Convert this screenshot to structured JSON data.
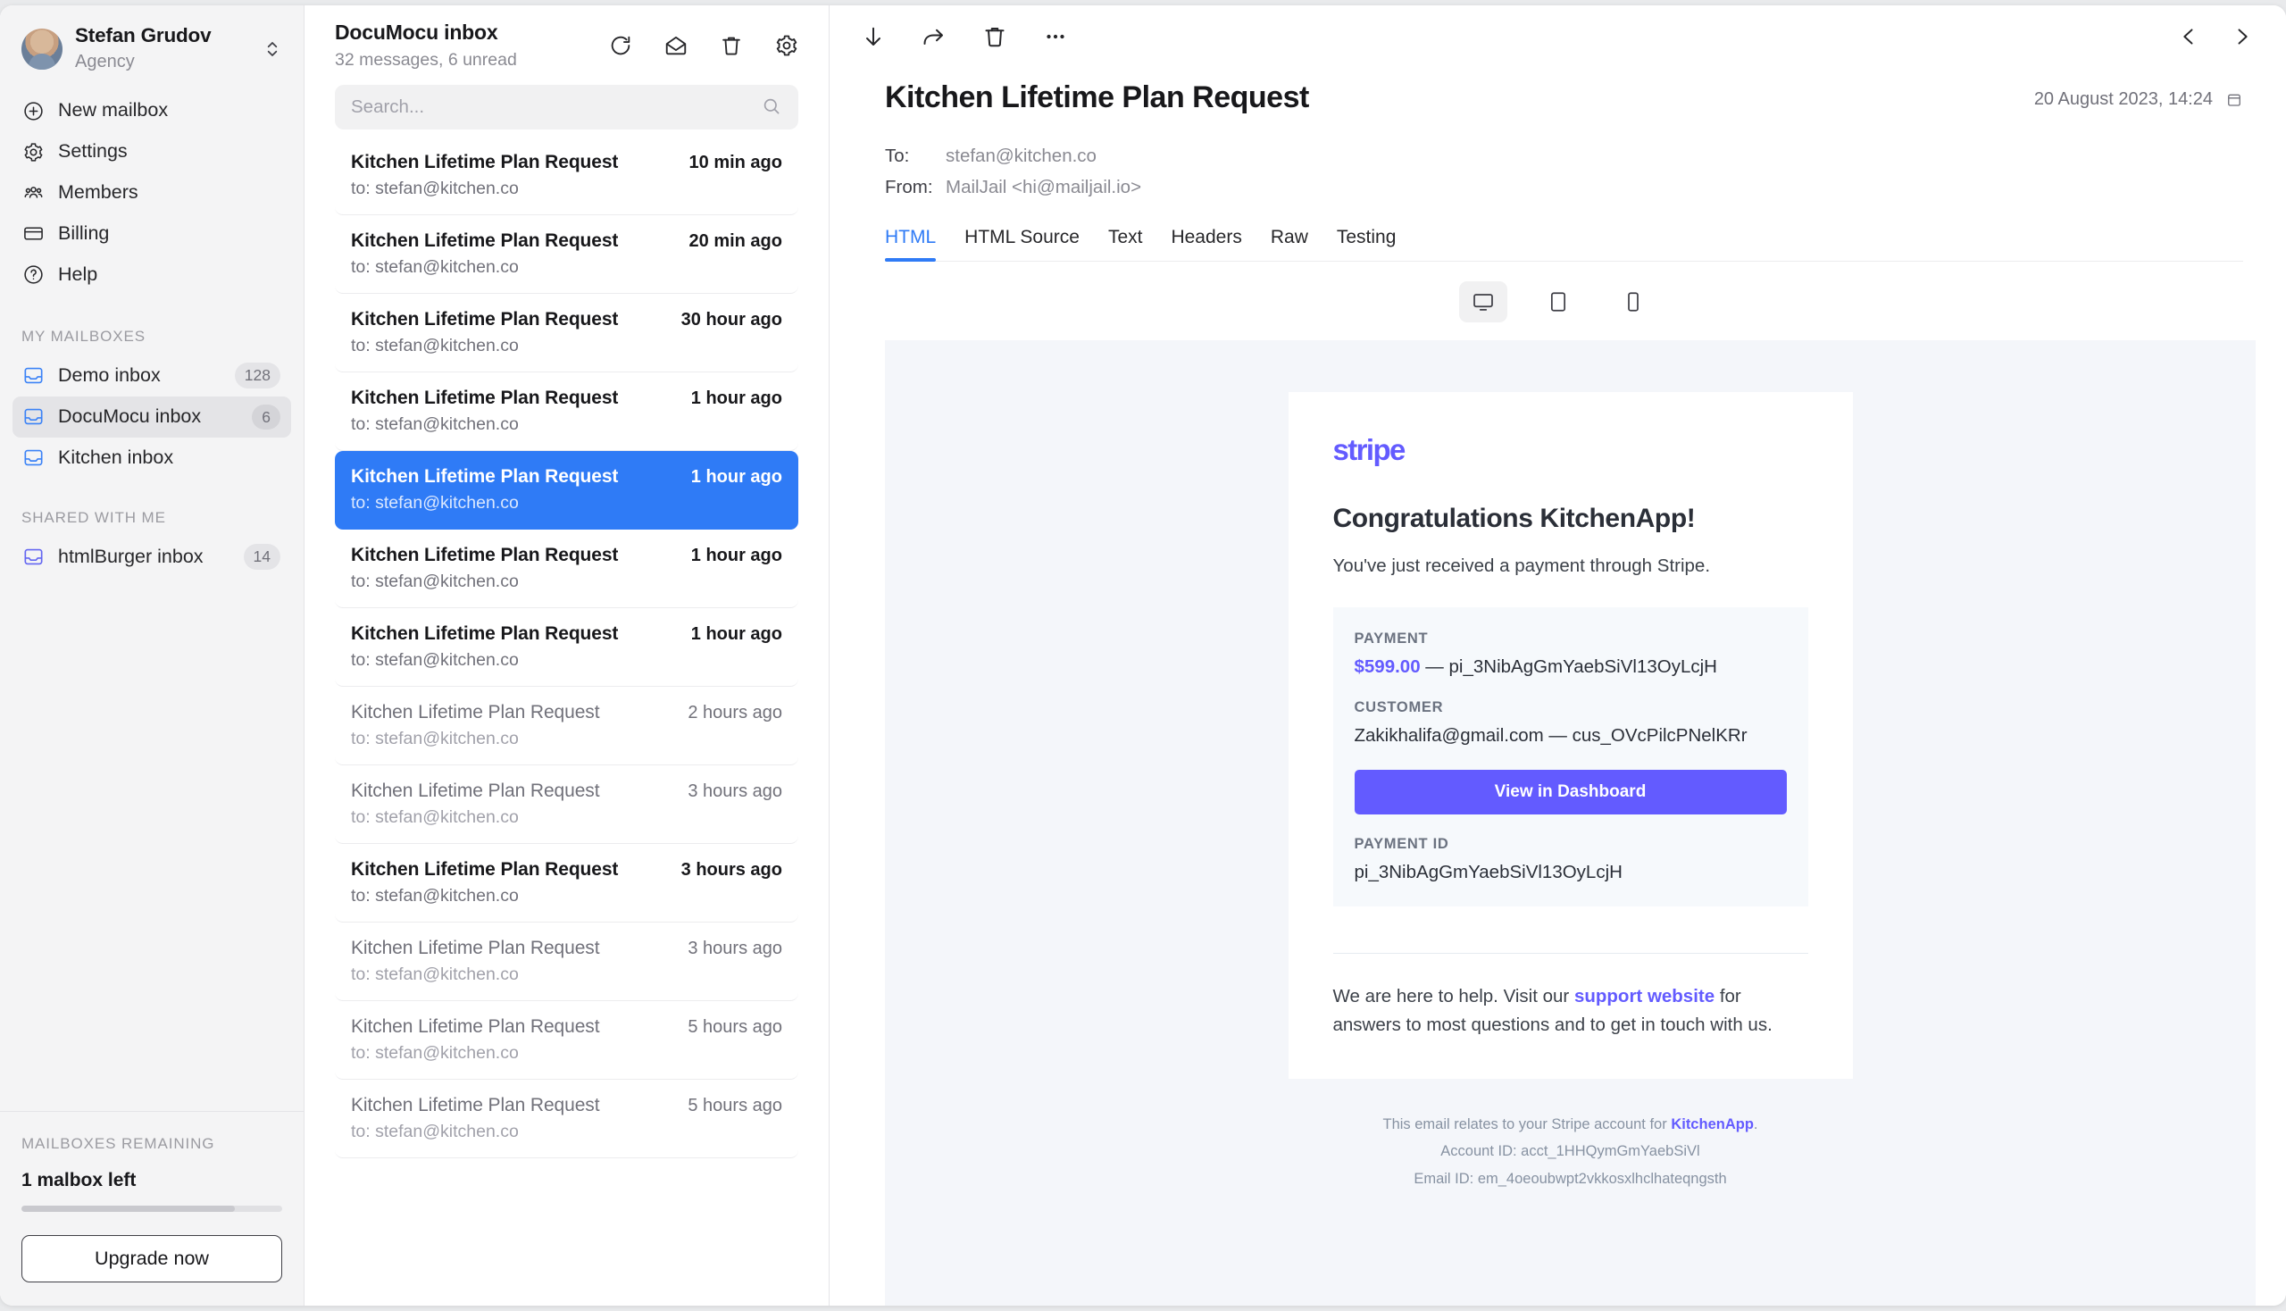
{
  "sidebar": {
    "account": {
      "name": "Stefan Grudov",
      "role": "Agency",
      "switcher_icon": "chevron-up-down-icon"
    },
    "nav": [
      {
        "label": "New mailbox",
        "icon": "plus-circle-icon"
      },
      {
        "label": "Settings",
        "icon": "gear-icon"
      },
      {
        "label": "Members",
        "icon": "users-icon"
      },
      {
        "label": "Billing",
        "icon": "credit-card-icon"
      },
      {
        "label": "Help",
        "icon": "question-circle-icon"
      }
    ],
    "my_mailboxes_label": "MY MAILBOXES",
    "my_mailboxes": [
      {
        "label": "Demo inbox",
        "badge": "128",
        "active": false
      },
      {
        "label": "DocuMocu inbox",
        "badge": "6",
        "active": true
      },
      {
        "label": "Kitchen inbox",
        "badge": "",
        "active": false
      }
    ],
    "shared_label": "SHARED WITH ME",
    "shared_mailboxes": [
      {
        "label": "htmlBurger inbox",
        "badge": "14",
        "active": false
      }
    ],
    "remaining": {
      "label": "MAILBOXES REMAINING",
      "value": "1 malbox left",
      "progress_percent": 82,
      "upgrade_label": "Upgrade now"
    }
  },
  "list": {
    "title": "DocuMocu inbox",
    "subtitle": "32 messages, 6 unread",
    "actions": [
      {
        "name": "refresh-button",
        "icon": "refresh-icon"
      },
      {
        "name": "mark-read-button",
        "icon": "open-envelope-icon"
      },
      {
        "name": "delete-button",
        "icon": "trash-icon"
      },
      {
        "name": "settings-button",
        "icon": "gear-icon"
      }
    ],
    "search_placeholder": "Search...",
    "search_value": "",
    "messages": [
      {
        "subject": "Kitchen Lifetime Plan Request",
        "time": "10 min ago",
        "to": "to: stefan@kitchen.co",
        "state": "unread"
      },
      {
        "subject": "Kitchen Lifetime Plan Request",
        "time": "20 min ago",
        "to": "to: stefan@kitchen.co",
        "state": "unread"
      },
      {
        "subject": "Kitchen Lifetime Plan Request",
        "time": "30 hour ago",
        "to": "to: stefan@kitchen.co",
        "state": "unread"
      },
      {
        "subject": "Kitchen Lifetime Plan Request",
        "time": "1 hour ago",
        "to": "to: stefan@kitchen.co",
        "state": "unread"
      },
      {
        "subject": "Kitchen Lifetime Plan Request",
        "time": "1 hour ago",
        "to": "to: stefan@kitchen.co",
        "state": "selected"
      },
      {
        "subject": "Kitchen Lifetime Plan Request",
        "time": "1 hour ago",
        "to": "to: stefan@kitchen.co",
        "state": "unread"
      },
      {
        "subject": "Kitchen Lifetime Plan Request",
        "time": "1 hour ago",
        "to": "to: stefan@kitchen.co",
        "state": "unread"
      },
      {
        "subject": "Kitchen Lifetime Plan Request",
        "time": "2 hours ago",
        "to": "to: stefan@kitchen.co",
        "state": "read"
      },
      {
        "subject": "Kitchen Lifetime Plan Request",
        "time": "3 hours ago",
        "to": "to: stefan@kitchen.co",
        "state": "read"
      },
      {
        "subject": "Kitchen Lifetime Plan Request",
        "time": "3 hours ago",
        "to": "to: stefan@kitchen.co",
        "state": "unread"
      },
      {
        "subject": "Kitchen Lifetime Plan Request",
        "time": "3 hours ago",
        "to": "to: stefan@kitchen.co",
        "state": "read"
      },
      {
        "subject": "Kitchen Lifetime Plan Request",
        "time": "5 hours ago",
        "to": "to: stefan@kitchen.co",
        "state": "read"
      },
      {
        "subject": "Kitchen Lifetime Plan Request",
        "time": "5 hours ago",
        "to": "to: stefan@kitchen.co",
        "state": "read"
      }
    ]
  },
  "reader": {
    "toolbar": [
      {
        "name": "download-button",
        "icon": "arrow-down-icon"
      },
      {
        "name": "forward-button",
        "icon": "forward-arrow-icon"
      },
      {
        "name": "delete-button",
        "icon": "trash-icon"
      },
      {
        "name": "more-options-button",
        "icon": "ellipsis-icon"
      }
    ],
    "prev_icon": "chevron-left-icon",
    "next_icon": "chevron-right-icon",
    "subject": "Kitchen Lifetime Plan Request",
    "date": "20 August 2023, 14:24",
    "date_icon": "calendar-icon",
    "to_key": "To:",
    "to_value": "stefan@kitchen.co",
    "from_key": "From:",
    "from_value": "MailJail <hi@mailjail.io>",
    "tabs": [
      {
        "label": "HTML",
        "active": true
      },
      {
        "label": "HTML Source",
        "active": false
      },
      {
        "label": "Text",
        "active": false
      },
      {
        "label": "Headers",
        "active": false
      },
      {
        "label": "Raw",
        "active": false
      },
      {
        "label": "Testing",
        "active": false
      }
    ],
    "viewports": [
      {
        "name": "desktop-view-button",
        "icon": "monitor-icon",
        "active": true
      },
      {
        "name": "tablet-view-button",
        "icon": "tablet-icon",
        "active": false
      },
      {
        "name": "mobile-view-button",
        "icon": "phone-icon",
        "active": false
      }
    ]
  },
  "email": {
    "brand": "stripe",
    "brand_color": "#635bff",
    "heading": "Congratulations KitchenApp!",
    "lede": "You've just received a payment through Stripe.",
    "payment_label": "PAYMENT",
    "payment_amount": "$599.00",
    "payment_sep": " — ",
    "payment_ref": "pi_3NibAgGmYaebSiVl13OyLcjH",
    "customer_label": "CUSTOMER",
    "customer_value": "Zakikhalifa@gmail.com — cus_OVcPilcPNelKRr",
    "dashboard_button": "View in Dashboard",
    "payment_id_label": "PAYMENT ID",
    "payment_id_value": "pi_3NibAgGmYaebSiVl13OyLcjH",
    "help_prefix": "We are here to help. Visit our ",
    "help_link": "support website",
    "help_suffix": " for answers to most questions and to get in touch with us.",
    "footer_relates_prefix": "This email relates to your Stripe account for ",
    "footer_account_name": "KitchenApp",
    "footer_relates_suffix": ".",
    "footer_account_id": "Account ID: acct_1HHQymGmYaebSiVl",
    "footer_email_id": "Email ID: em_4oeoubwpt2vkkosxlhclhateqngsth"
  }
}
